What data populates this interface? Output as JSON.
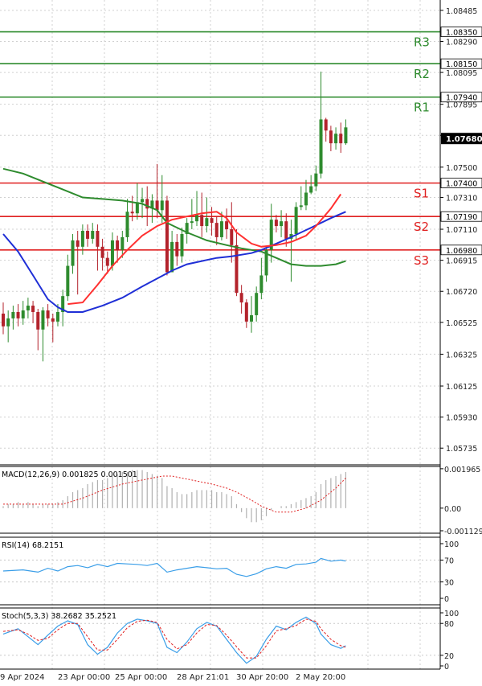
{
  "chart_data": {
    "type": "line",
    "subtype": "candlestick",
    "instrument": "",
    "price_axis": {
      "ticks": [
        "1.08485",
        "1.08290",
        "1.08095",
        "1.07895",
        "1.07700",
        "1.07500",
        "1.07310",
        "1.07110",
        "1.06915",
        "1.06720",
        "1.06525",
        "1.06325",
        "1.06125",
        "1.05930",
        "1.05735"
      ],
      "range": [
        1.0563,
        1.0855
      ],
      "current_price": "1.07680",
      "current_price_value": 1.0768
    },
    "levels": [
      {
        "name": "R3",
        "value": 1.0835,
        "label": "1.08350",
        "kind": "resistance",
        "color": "#2e8b2e"
      },
      {
        "name": "R2",
        "value": 1.0815,
        "label": "1.08150",
        "kind": "resistance",
        "color": "#2e8b2e"
      },
      {
        "name": "R1",
        "value": 1.0794,
        "label": "1.07940",
        "kind": "resistance",
        "color": "#2e8b2e"
      },
      {
        "name": "S1",
        "value": 1.074,
        "label": "1.07400",
        "kind": "support",
        "color": "#e02020"
      },
      {
        "name": "S2",
        "value": 1.0719,
        "label": "1.07190",
        "kind": "support",
        "color": "#e02020"
      },
      {
        "name": "S3",
        "value": 1.0698,
        "label": "1.06980",
        "kind": "support",
        "color": "#e02020"
      }
    ],
    "x_ticks": [
      "9 Apr 2024",
      "23 Apr 00:00",
      "25 Apr 00:00",
      "28 Apr 21:01",
      "30 Apr 20:00",
      "2 May 20:00"
    ],
    "candles": [
      [
        1.0658,
        1.065,
        1.0665,
        1.0645
      ],
      [
        1.065,
        1.0655,
        1.066,
        1.064
      ],
      [
        1.0655,
        1.0659,
        1.0663,
        1.0648
      ],
      [
        1.0659,
        1.0655,
        1.0664,
        1.065
      ],
      [
        1.0655,
        1.066,
        1.0666,
        1.0651
      ],
      [
        1.066,
        1.0663,
        1.0668,
        1.0655
      ],
      [
        1.0663,
        1.0659,
        1.0666,
        1.0652
      ],
      [
        1.0659,
        1.0648,
        1.0661,
        1.0635
      ],
      [
        1.0648,
        1.066,
        1.0662,
        1.0628
      ],
      [
        1.066,
        1.0655,
        1.0664,
        1.065
      ],
      [
        1.0655,
        1.0653,
        1.0658,
        1.064
      ],
      [
        1.0653,
        1.0659,
        1.0664,
        1.065
      ],
      [
        1.0659,
        1.0669,
        1.0673,
        1.065
      ],
      [
        1.0669,
        1.0688,
        1.0695,
        1.0666
      ],
      [
        1.0688,
        1.0704,
        1.0708,
        1.0683
      ],
      [
        1.0704,
        1.07,
        1.071,
        1.067
      ],
      [
        1.07,
        1.071,
        1.0714,
        1.0695
      ],
      [
        1.071,
        1.0705,
        1.0714,
        1.07
      ],
      [
        1.0705,
        1.071,
        1.0715,
        1.0702
      ],
      [
        1.071,
        1.07,
        1.0714,
        1.0685
      ],
      [
        1.07,
        1.0693,
        1.0705,
        1.0685
      ],
      [
        1.0693,
        1.0688,
        1.0697,
        1.0683
      ],
      [
        1.0688,
        1.0704,
        1.0709,
        1.0685
      ],
      [
        1.0704,
        1.0698,
        1.0707,
        1.069
      ],
      [
        1.0698,
        1.0706,
        1.071,
        1.0693
      ],
      [
        1.0706,
        1.0722,
        1.073,
        1.0703
      ],
      [
        1.0722,
        1.0721,
        1.0732,
        1.0716
      ],
      [
        1.0721,
        1.0728,
        1.074,
        1.0717
      ],
      [
        1.0728,
        1.073,
        1.0737,
        1.0718
      ],
      [
        1.073,
        1.0724,
        1.0738,
        1.0713
      ],
      [
        1.0724,
        1.0729,
        1.0733,
        1.0715
      ],
      [
        1.0729,
        1.0723,
        1.0752,
        1.0718
      ],
      [
        1.0723,
        1.0729,
        1.0745,
        1.0715
      ],
      [
        1.0729,
        1.0684,
        1.0732,
        1.0682
      ],
      [
        1.0684,
        1.0703,
        1.071,
        1.0697
      ],
      [
        1.0703,
        1.0694,
        1.0708,
        1.0688
      ],
      [
        1.0694,
        1.0708,
        1.0712,
        1.069
      ],
      [
        1.0708,
        1.0715,
        1.0718,
        1.0702
      ],
      [
        1.0715,
        1.0716,
        1.073,
        1.0711
      ],
      [
        1.0716,
        1.072,
        1.0735,
        1.0713
      ],
      [
        1.072,
        1.0713,
        1.0734,
        1.0706
      ],
      [
        1.0713,
        1.0718,
        1.0731,
        1.0709
      ],
      [
        1.0718,
        1.0715,
        1.0725,
        1.0707
      ],
      [
        1.0715,
        1.0706,
        1.0719,
        1.0701
      ],
      [
        1.0706,
        1.0716,
        1.0722,
        1.0704
      ],
      [
        1.0716,
        1.0711,
        1.0724,
        1.0705
      ],
      [
        1.0711,
        1.0701,
        1.0728,
        1.069
      ],
      [
        1.0701,
        1.0671,
        1.0711,
        1.0669
      ],
      [
        1.0671,
        1.0665,
        1.0676,
        1.0658
      ],
      [
        1.0665,
        1.0653,
        1.0667,
        1.0649
      ],
      [
        1.0653,
        1.0657,
        1.0669,
        1.0646
      ],
      [
        1.0657,
        1.0671,
        1.0675,
        1.0653
      ],
      [
        1.0671,
        1.0682,
        1.0693,
        1.0667
      ],
      [
        1.0682,
        1.0698,
        1.07,
        1.0678
      ],
      [
        1.0698,
        1.0717,
        1.0727,
        1.069
      ],
      [
        1.0717,
        1.0713,
        1.072,
        1.0709
      ],
      [
        1.0713,
        1.0716,
        1.0723,
        1.0706
      ],
      [
        1.0716,
        1.0705,
        1.0721,
        1.07
      ],
      [
        1.0705,
        1.0708,
        1.0717,
        1.0678
      ],
      [
        1.0708,
        1.0725,
        1.0728,
        1.0704
      ],
      [
        1.0725,
        1.0726,
        1.0738,
        1.0723
      ],
      [
        1.0726,
        1.0734,
        1.0742,
        1.0723
      ],
      [
        1.0734,
        1.0738,
        1.0745,
        1.0733
      ],
      [
        1.0738,
        1.0746,
        1.0751,
        1.0735
      ],
      [
        1.0746,
        1.078,
        1.081,
        1.0743
      ],
      [
        1.078,
        1.0773,
        1.0781,
        1.0766
      ],
      [
        1.0773,
        1.0765,
        1.0776,
        1.076
      ],
      [
        1.0765,
        1.0771,
        1.0775,
        1.0761
      ],
      [
        1.0771,
        1.0765,
        1.0778,
        1.0759
      ],
      [
        1.0765,
        1.0775,
        1.078,
        1.0764
      ]
    ],
    "moving_averages": [
      {
        "color": "#2e8b2e",
        "points": [
          [
            0,
            1.0749
          ],
          [
            4,
            1.0746
          ],
          [
            8,
            1.0741
          ],
          [
            12,
            1.0736
          ],
          [
            16,
            1.0731
          ],
          [
            20,
            1.073
          ],
          [
            24,
            1.0729
          ],
          [
            28,
            1.0727
          ],
          [
            31,
            1.0723
          ],
          [
            33,
            1.0715
          ],
          [
            37,
            1.0709
          ],
          [
            41,
            1.0704
          ],
          [
            45,
            1.0701
          ],
          [
            48,
            1.0699
          ],
          [
            52,
            1.0697
          ],
          [
            55,
            1.0693
          ],
          [
            58,
            1.0689
          ],
          [
            61,
            1.0688
          ],
          [
            64,
            1.0688
          ],
          [
            67,
            1.0689
          ],
          [
            69,
            1.0691
          ]
        ]
      },
      {
        "color": "#1f2fd6",
        "points": [
          [
            0,
            1.0708
          ],
          [
            3,
            1.0697
          ],
          [
            6,
            1.0682
          ],
          [
            9,
            1.0667
          ],
          [
            11,
            1.0662
          ],
          [
            13,
            1.0659
          ],
          [
            16,
            1.0659
          ],
          [
            20,
            1.0663
          ],
          [
            24,
            1.0668
          ],
          [
            28,
            1.0675
          ],
          [
            31,
            1.068
          ],
          [
            34,
            1.0685
          ],
          [
            37,
            1.0689
          ],
          [
            40,
            1.0691
          ],
          [
            43,
            1.0693
          ],
          [
            46,
            1.0694
          ],
          [
            50,
            1.0696
          ],
          [
            52,
            1.0698
          ],
          [
            55,
            1.0702
          ],
          [
            58,
            1.0706
          ],
          [
            62,
            1.0712
          ],
          [
            66,
            1.0718
          ],
          [
            69,
            1.0722
          ]
        ]
      },
      {
        "color": "#ff3030",
        "points": [
          [
            13,
            1.0664
          ],
          [
            16,
            1.0665
          ],
          [
            19,
            1.0676
          ],
          [
            22,
            1.0688
          ],
          [
            25,
            1.0698
          ],
          [
            28,
            1.0707
          ],
          [
            31,
            1.0713
          ],
          [
            34,
            1.0717
          ],
          [
            37,
            1.0719
          ],
          [
            40,
            1.0721
          ],
          [
            43,
            1.0722
          ],
          [
            45,
            1.0718
          ],
          [
            47,
            1.0709
          ],
          [
            50,
            1.0702
          ],
          [
            52,
            1.07
          ],
          [
            55,
            1.0701
          ],
          [
            58,
            1.0703
          ],
          [
            61,
            1.0707
          ],
          [
            63,
            1.0713
          ],
          [
            66,
            1.0724
          ],
          [
            68,
            1.0733
          ]
        ]
      }
    ],
    "macd": {
      "label": "MACD(12,26,9) 0.001825 0.001501",
      "ticks": [
        "0.001965",
        "0.00",
        "-0.001129"
      ],
      "range": [
        -0.00125,
        0.00208
      ],
      "histogram": [
        0.0001,
        0.0002,
        0.0002,
        0.0003,
        0.0002,
        0.0003,
        0.0002,
        0.0001,
        0.0002,
        0.0002,
        0.0002,
        0.0003,
        0.0004,
        0.0006,
        0.0008,
        0.0009,
        0.001,
        0.0012,
        0.0013,
        0.0014,
        0.0014,
        0.0015,
        0.0016,
        0.0017,
        0.0018,
        0.0018,
        0.0019,
        0.0019,
        0.0019,
        0.0018,
        0.0017,
        0.0016,
        0.0015,
        0.0011,
        0.001,
        0.0008,
        0.0007,
        0.0007,
        0.0008,
        0.0009,
        0.0009,
        0.0009,
        0.0009,
        0.0008,
        0.0008,
        0.0007,
        0.0006,
        0.0002,
        -0.0002,
        -0.0005,
        -0.0007,
        -0.0007,
        -0.0006,
        -0.0004,
        -0.0001,
        0.0,
        0.0001,
        0.0001,
        0.0002,
        0.0003,
        0.0004,
        0.0005,
        0.0006,
        0.0008,
        0.0012,
        0.0014,
        0.0015,
        0.0016,
        0.0017,
        0.0018
      ],
      "signal": [
        [
          0,
          0.0002
        ],
        [
          8,
          0.0002
        ],
        [
          12,
          0.0002
        ],
        [
          16,
          0.0005
        ],
        [
          20,
          0.0009
        ],
        [
          24,
          0.0012
        ],
        [
          28,
          0.0014
        ],
        [
          32,
          0.0016
        ],
        [
          34,
          0.0016
        ],
        [
          38,
          0.0014
        ],
        [
          42,
          0.0012
        ],
        [
          45,
          0.001
        ],
        [
          47,
          0.0008
        ],
        [
          50,
          0.0004
        ],
        [
          52,
          0.0001
        ],
        [
          55,
          -0.0002
        ],
        [
          58,
          -0.0002
        ],
        [
          61,
          0.0
        ],
        [
          64,
          0.0004
        ],
        [
          67,
          0.001
        ],
        [
          69,
          0.0015
        ]
      ]
    },
    "rsi": {
      "label": "RSI(14) 68.2151",
      "ticks": [
        "100",
        "70",
        "30",
        "0"
      ],
      "range": [
        0,
        100
      ],
      "values": [
        [
          0,
          50
        ],
        [
          4,
          52
        ],
        [
          7,
          48
        ],
        [
          9,
          55
        ],
        [
          11,
          50
        ],
        [
          13,
          58
        ],
        [
          15,
          60
        ],
        [
          17,
          56
        ],
        [
          19,
          62
        ],
        [
          21,
          58
        ],
        [
          23,
          64
        ],
        [
          25,
          63
        ],
        [
          27,
          62
        ],
        [
          29,
          60
        ],
        [
          31,
          64
        ],
        [
          33,
          48
        ],
        [
          35,
          52
        ],
        [
          37,
          55
        ],
        [
          39,
          58
        ],
        [
          41,
          56
        ],
        [
          43,
          54
        ],
        [
          45,
          55
        ],
        [
          47,
          44
        ],
        [
          49,
          40
        ],
        [
          51,
          45
        ],
        [
          53,
          54
        ],
        [
          55,
          58
        ],
        [
          57,
          55
        ],
        [
          59,
          62
        ],
        [
          61,
          63
        ],
        [
          63,
          66
        ],
        [
          64,
          73
        ],
        [
          66,
          68
        ],
        [
          68,
          70
        ],
        [
          69,
          68.2
        ]
      ]
    },
    "stoch": {
      "label": "Stoch(5,3,3) 38.2682 35.2521",
      "ticks": [
        "100",
        "80",
        "20",
        "0"
      ],
      "range": [
        0,
        100
      ],
      "k": [
        [
          0,
          60
        ],
        [
          3,
          70
        ],
        [
          5,
          55
        ],
        [
          7,
          40
        ],
        [
          9,
          58
        ],
        [
          11,
          75
        ],
        [
          13,
          85
        ],
        [
          15,
          78
        ],
        [
          17,
          40
        ],
        [
          19,
          22
        ],
        [
          21,
          35
        ],
        [
          23,
          62
        ],
        [
          25,
          80
        ],
        [
          27,
          88
        ],
        [
          29,
          85
        ],
        [
          31,
          80
        ],
        [
          33,
          35
        ],
        [
          35,
          25
        ],
        [
          37,
          45
        ],
        [
          39,
          70
        ],
        [
          41,
          82
        ],
        [
          43,
          75
        ],
        [
          45,
          50
        ],
        [
          47,
          25
        ],
        [
          49,
          5
        ],
        [
          51,
          18
        ],
        [
          53,
          50
        ],
        [
          55,
          75
        ],
        [
          57,
          68
        ],
        [
          59,
          82
        ],
        [
          61,
          92
        ],
        [
          63,
          80
        ],
        [
          64,
          60
        ],
        [
          66,
          40
        ],
        [
          68,
          33
        ],
        [
          69,
          38
        ]
      ],
      "d": [
        [
          0,
          65
        ],
        [
          3,
          68
        ],
        [
          5,
          60
        ],
        [
          7,
          48
        ],
        [
          9,
          52
        ],
        [
          11,
          68
        ],
        [
          13,
          80
        ],
        [
          15,
          80
        ],
        [
          17,
          55
        ],
        [
          19,
          30
        ],
        [
          21,
          30
        ],
        [
          23,
          50
        ],
        [
          25,
          72
        ],
        [
          27,
          84
        ],
        [
          29,
          86
        ],
        [
          31,
          82
        ],
        [
          33,
          50
        ],
        [
          35,
          32
        ],
        [
          37,
          40
        ],
        [
          39,
          62
        ],
        [
          41,
          78
        ],
        [
          43,
          76
        ],
        [
          45,
          58
        ],
        [
          47,
          36
        ],
        [
          49,
          15
        ],
        [
          51,
          15
        ],
        [
          53,
          38
        ],
        [
          55,
          66
        ],
        [
          57,
          70
        ],
        [
          59,
          76
        ],
        [
          61,
          88
        ],
        [
          63,
          84
        ],
        [
          64,
          70
        ],
        [
          66,
          50
        ],
        [
          68,
          38
        ],
        [
          69,
          35
        ]
      ]
    }
  }
}
